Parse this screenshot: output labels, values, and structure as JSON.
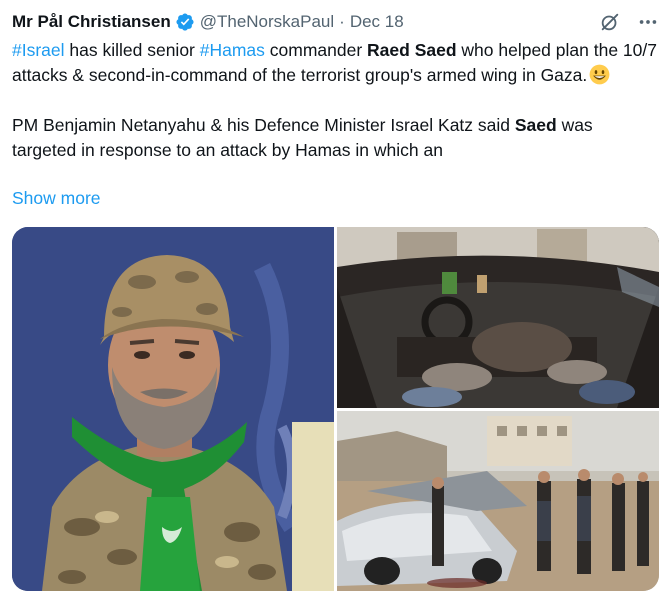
{
  "author": {
    "name": "Mr Pål Christiansen",
    "handle": "@TheNorskaPaul",
    "separator": "·",
    "date": "Dec 18"
  },
  "icons": {
    "verified": "verified-badge-icon",
    "grok": "grok-icon",
    "more": "more-icon",
    "emoji": "grinning-face-emoji"
  },
  "colors": {
    "link": "#1d9bf0",
    "text": "#0f1419",
    "muted": "#536471"
  },
  "tweet": {
    "p1": {
      "hashtag1": "#Israel",
      "t1": " has killed senior ",
      "hashtag2": "#Hamas",
      "t2": " commander ",
      "bold1": "Raed Saed",
      "t3": " who helped plan the 10/7 attacks & second-in-command of the terrorist group's armed wing in Gaza."
    },
    "p2": {
      "t1": "PM Benjamin Netanyahu & his Defence Minister Israel Katz said ",
      "bold1": "Saed",
      "t2": " was targeted in response to an attack by Hamas in which an"
    },
    "show_more": "Show more"
  }
}
